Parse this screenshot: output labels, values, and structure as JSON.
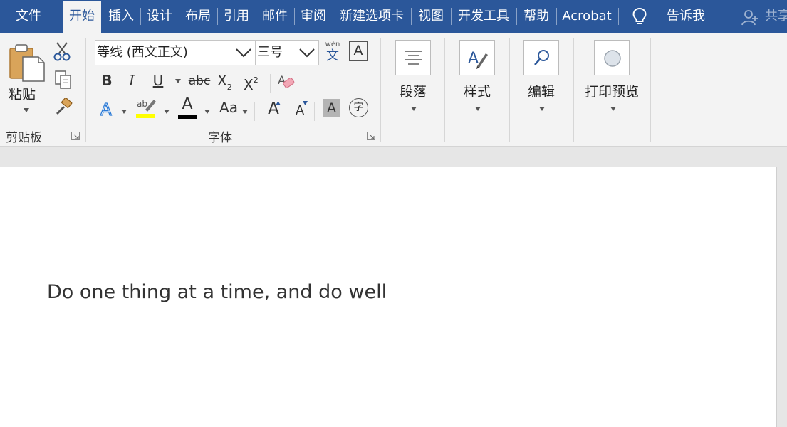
{
  "tabs": [
    "文件",
    "开始",
    "插入",
    "设计",
    "布局",
    "引用",
    "邮件",
    "审阅",
    "新建选项卡",
    "视图",
    "开发工具",
    "帮助",
    "Acrobat"
  ],
  "active_tab": "开始",
  "tell_me": "告诉我",
  "share": "共享",
  "colors": {
    "tab_bar": "#2b579a",
    "ribbon": "#f3f3f3",
    "accent_blue": "#2b579a",
    "highlight_yellow": "#ffff00",
    "font_color_black": "#000000"
  },
  "clipboard": {
    "paste_label": "粘贴",
    "group_label": "剪贴板"
  },
  "font": {
    "group_label": "字体",
    "font_name": "等线 (西文正文)",
    "font_size": "三号",
    "phonetic_top": "wén",
    "phonetic_bottom": "文",
    "bold": "B",
    "italic": "I",
    "underline": "U",
    "strikethrough": "abc",
    "subscript_base": "X",
    "subscript_mark": "2",
    "superscript_base": "X",
    "superscript_mark": "2",
    "change_case": "Aa",
    "grow_font": "A",
    "shrink_font": "A",
    "border_char": "A",
    "shading_char": "A",
    "text_color_char": "A",
    "enclose_char": "字"
  },
  "paragraph": {
    "label": "段落"
  },
  "styles": {
    "label": "样式"
  },
  "editing": {
    "label": "编辑"
  },
  "print_preview": {
    "label": "打印预览"
  },
  "document": {
    "text": "Do one thing at a time, and do well"
  }
}
